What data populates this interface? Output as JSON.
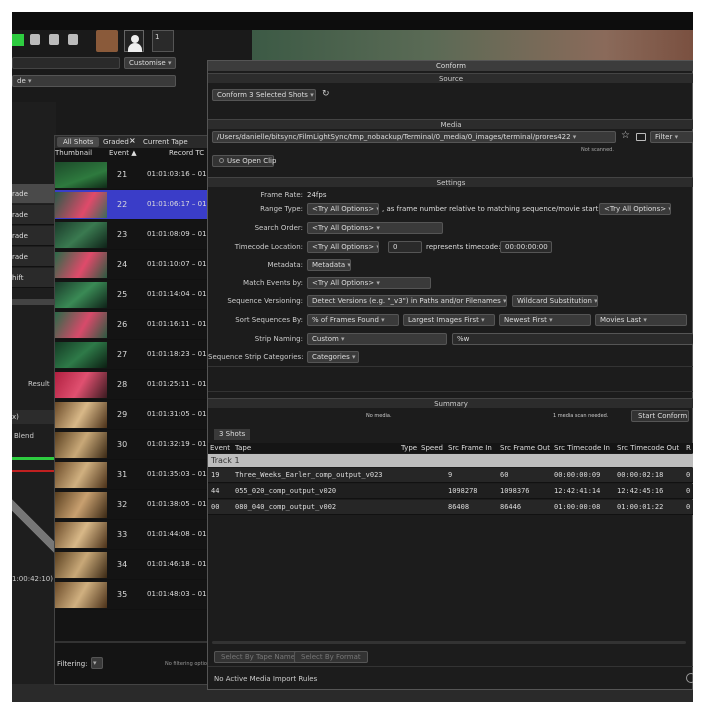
{
  "top_toolbar": {
    "customise_label": "Customise",
    "counter": "1",
    "left_dropdown_text": "de"
  },
  "left_panel": {
    "items": [
      "rade",
      "rade",
      "rade",
      "rade",
      "hift"
    ],
    "result_label": "Result",
    "x_label": "x)",
    "blend_label": "Blend",
    "timecode": "1:00:42:10)"
  },
  "shots_panel": {
    "tabs": [
      "All Shots",
      "Graded",
      "Current Tape"
    ],
    "columns": [
      "Thumbnail",
      "Event",
      "Record TC"
    ],
    "rows": [
      {
        "event": "21",
        "tc": "01:01:03:16 – 01"
      },
      {
        "event": "22",
        "tc": "01:01:06:17 – 01"
      },
      {
        "event": "23",
        "tc": "01:01:08:09 – 01"
      },
      {
        "event": "24",
        "tc": "01:01:10:07 – 01"
      },
      {
        "event": "25",
        "tc": "01:01:14:04 – 01"
      },
      {
        "event": "26",
        "tc": "01:01:16:11 – 01"
      },
      {
        "event": "27",
        "tc": "01:01:18:23 – 01"
      },
      {
        "event": "28",
        "tc": "01:01:25:11 – 01"
      },
      {
        "event": "29",
        "tc": "01:01:31:05 – 01"
      },
      {
        "event": "30",
        "tc": "01:01:32:19 – 01"
      },
      {
        "event": "31",
        "tc": "01:01:35:03 – 01"
      },
      {
        "event": "32",
        "tc": "01:01:38:05 – 01"
      },
      {
        "event": "33",
        "tc": "01:01:44:08 – 01"
      },
      {
        "event": "34",
        "tc": "01:01:46:18 – 01"
      },
      {
        "event": "35",
        "tc": "01:01:48:03 – 01"
      }
    ],
    "filtering_label": "Filtering:",
    "filtering_status": "No filtering optio"
  },
  "conform": {
    "title": "Conform",
    "source_header": "Source",
    "source_dropdown": "Conform 3 Selected Shots",
    "media_header": "Media",
    "media_path": "/Users/danielle/bitsync/FilmLightSync/tmp_nobackup/Terminal/0_media/0_images/terminal/prores422",
    "filter_label": "Filter",
    "not_scanned": "Not scanned.",
    "use_open_clip": "Use Open Clip",
    "settings_header": "Settings",
    "frame_rate_label": "Frame Rate:",
    "frame_rate_value": "24fps",
    "range_type_label": "Range Type:",
    "range_type_value": "<Try All Options>",
    "range_type_text": ", as frame number relative to matching sequence/movie start:",
    "range_type_value2": "<Try All Options>",
    "search_order_label": "Search Order:",
    "search_order_value": "<Try All Options>",
    "timecode_location_label": "Timecode Location:",
    "timecode_location_value": "<Try All Options>",
    "timecode_offset": "0",
    "represents_timecode_text": "represents timecode:",
    "represents_timecode_value": "00:00:00:00",
    "metadata_label": "Metadata:",
    "metadata_value": "Metadata",
    "match_events_label": "Match Events by:",
    "match_events_value": "<Try All Options>",
    "sequence_versioning_label": "Sequence Versioning:",
    "sequence_versioning_value": "Detect Versions (e.g. \"_v3\") in Paths and/or Filenames",
    "wildcard_substitution": "Wildcard Substitution",
    "sort_sequences_label": "Sort Sequences By:",
    "sort_values": [
      "% of Frames Found",
      "Largest Images First",
      "Newest First",
      "Movies Last"
    ],
    "strip_naming_label": "Strip Naming:",
    "strip_naming_value": "Custom",
    "strip_naming_pattern": "%w",
    "sequence_strip_categories_label": "Sequence Strip Categories:",
    "sequence_strip_categories_value": "Categories",
    "summary_header": "Summary",
    "no_media": "No media.",
    "media_scan_needed": "1 media scan needed.",
    "start_conform": "Start Conform",
    "shots_tab": "3 Shots",
    "table_columns": [
      "Event",
      "Tape",
      "Type",
      "Speed",
      "Src Frame In",
      "Src Frame Out",
      "Src Timecode In",
      "Src Timecode Out",
      "R"
    ],
    "track_label": "Track 1",
    "table_rows": [
      {
        "event": "19",
        "tape": "Three_Weeks_Earler_comp_output_v023",
        "frame_in": "9",
        "frame_out": "60",
        "tc_in": "00:00:00:09",
        "tc_out": "00:00:02:18",
        "r": "0"
      },
      {
        "event": "44",
        "tape": "055_020_comp_output_v020",
        "frame_in": "1098278",
        "frame_out": "1098376",
        "tc_in": "12:42:41:14",
        "tc_out": "12:42:45:16",
        "r": "0"
      },
      {
        "event": "00",
        "tape": "080_040_comp_output_v002",
        "frame_in": "86408",
        "frame_out": "86446",
        "tc_in": "01:00:00:08",
        "tc_out": "01:00:01:22",
        "r": "0"
      }
    ],
    "select_by_tape_name": "Select By Tape Name",
    "select_by_format": "Select By Format",
    "no_active_rules": "No Active Media Import Rules"
  },
  "colors": {
    "accent_green": "#2ecc40",
    "selected_row": "#3a3dc8",
    "window_bg": "#1c1c1c",
    "panel_header": "#3c3c3c"
  }
}
